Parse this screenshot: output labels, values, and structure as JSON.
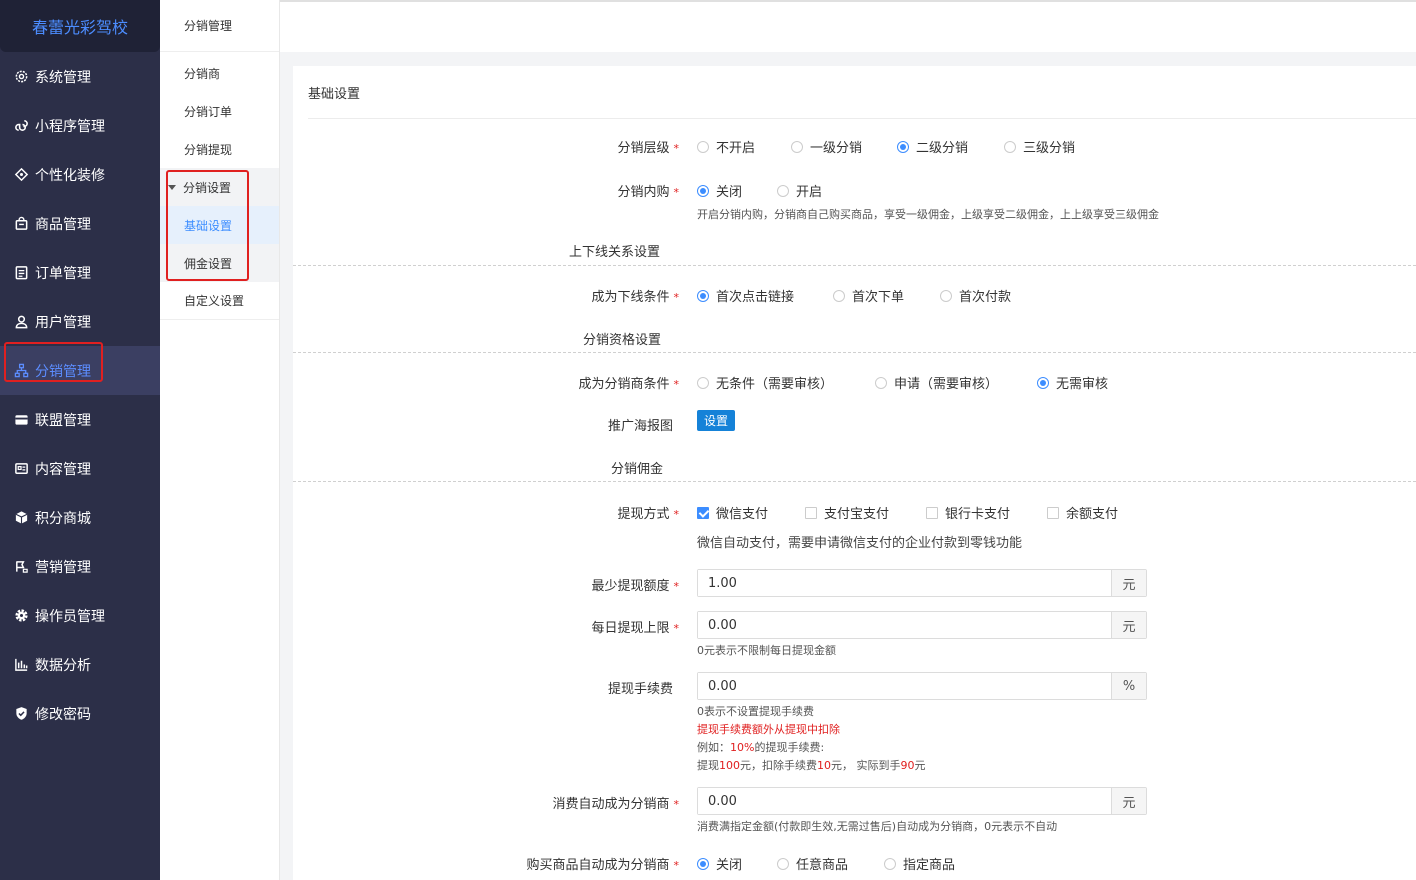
{
  "brand": "春蕾光彩驾校",
  "sidebar": {
    "items": [
      {
        "label": "系统管理",
        "icon": "gear-outline-icon"
      },
      {
        "label": "小程序管理",
        "icon": "mini-program-icon"
      },
      {
        "label": "个性化装修",
        "icon": "palette-icon"
      },
      {
        "label": "商品管理",
        "icon": "bag-icon"
      },
      {
        "label": "订单管理",
        "icon": "order-list-icon"
      },
      {
        "label": "用户管理",
        "icon": "user-icon"
      },
      {
        "label": "分销管理",
        "icon": "org-chart-icon"
      },
      {
        "label": "联盟管理",
        "icon": "card-icon"
      },
      {
        "label": "内容管理",
        "icon": "content-icon"
      },
      {
        "label": "积分商城",
        "icon": "cube-icon"
      },
      {
        "label": "营销管理",
        "icon": "marketing-icon"
      },
      {
        "label": "操作员管理",
        "icon": "gear-solid-icon"
      },
      {
        "label": "数据分析",
        "icon": "bar-chart-icon"
      },
      {
        "label": "修改密码",
        "icon": "shield-check-icon"
      }
    ],
    "active_index": 6,
    "active_color": "#5c8dff"
  },
  "submenu": {
    "title": "分销管理",
    "items": [
      "分销商",
      "分销订单",
      "分销提现"
    ],
    "group": "分销设置",
    "children": [
      "基础设置",
      "佣金设置"
    ],
    "active_child": "基础设置",
    "after": "自定义设置"
  },
  "panel": {
    "title": "基础设置",
    "level": {
      "label": "分销层级",
      "options": [
        "不开启",
        "一级分销",
        "二级分销",
        "三级分销"
      ],
      "selected": "二级分销"
    },
    "internal": {
      "label": "分销内购",
      "options": [
        "关闭",
        "开启"
      ],
      "selected": "关闭",
      "hint": "开启分销内购，分销商自己购买商品，享受一级佣金，上级享受二级佣金，上上级享受三级佣金"
    },
    "section_relation": "上下线关系设置",
    "downline": {
      "label": "成为下线条件",
      "options": [
        "首次点击链接",
        "首次下单",
        "首次付款"
      ],
      "selected": "首次点击链接"
    },
    "section_qualify": "分销资格设置",
    "become": {
      "label": "成为分销商条件",
      "options": [
        "无条件（需要审核）",
        "申请（需要审核）",
        "无需审核"
      ],
      "selected": "无需审核"
    },
    "poster": {
      "label": "推广海报图",
      "button": "设置"
    },
    "section_commission": "分销佣金",
    "withdraw_method": {
      "label": "提现方式",
      "options": [
        "微信支付",
        "支付宝支付",
        "银行卡支付",
        "余额支付"
      ],
      "checked": [
        "微信支付"
      ],
      "hint": "微信自动支付，需要申请微信支付的企业付款到零钱功能"
    },
    "min_withdraw": {
      "label": "最少提现额度",
      "value": "1.00",
      "unit": "元"
    },
    "daily_limit": {
      "label": "每日提现上限",
      "value": "0.00",
      "unit": "元",
      "hint": "0元表示不限制每日提现金额"
    },
    "fee": {
      "label": "提现手续费",
      "value": "0.00",
      "unit": "%",
      "hint1": "0表示不设置提现手续费",
      "hint2": "提现手续费额外从提现中扣除",
      "hint3_a": "例如：",
      "hint3_b": "10%",
      "hint3_c": "的提现手续费:",
      "hint4_a": "提现",
      "hint4_b": "100",
      "hint4_c": "元，扣除手续费",
      "hint4_d": "10",
      "hint4_e": "元，  实际到手",
      "hint4_f": "90",
      "hint4_g": "元"
    },
    "auto_consume": {
      "label": "消费自动成为分销商",
      "value": "0.00",
      "unit": "元",
      "hint": "消费满指定金额(付款即生效,无需过售后)自动成为分销商，0元表示不自动"
    },
    "auto_buy": {
      "label": "购买商品自动成为分销商",
      "options": [
        "关闭",
        "任意商品",
        "指定商品"
      ],
      "selected": "关闭"
    }
  },
  "colors": {
    "sidebar_bg": "#2c2f48",
    "accent": "#3c8dff",
    "required": "#e02020",
    "annotation_box": "#e02020"
  }
}
